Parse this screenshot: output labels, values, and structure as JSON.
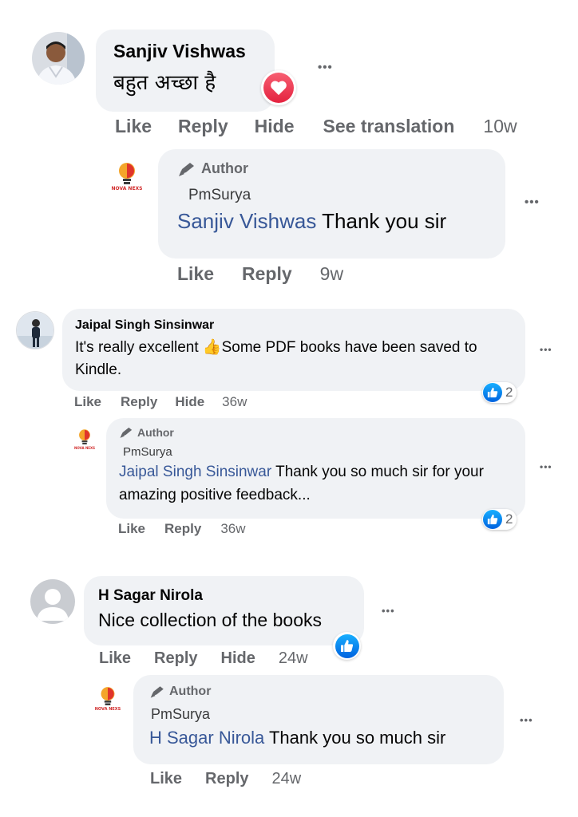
{
  "comments": [
    {
      "name": "Sanjiv Vishwas",
      "text": "बहुत अच्छा है",
      "reaction_icon": "heart-reaction-icon",
      "actions": {
        "like": "Like",
        "reply": "Reply",
        "hide": "Hide",
        "translate": "See translation",
        "time": "10w"
      },
      "more": "•••",
      "reply": {
        "badge": "Author",
        "author": "PmSurya",
        "mention": "Sanjiv Vishwas",
        "text": " Thank you sir",
        "logo_text": "NOVA NEXS",
        "actions": {
          "like": "Like",
          "reply": "Reply",
          "time": "9w"
        },
        "more": "•••"
      }
    },
    {
      "name": "Jaipal Singh Sinsinwar",
      "text_before": "It's really excellent ",
      "emoji": "👍",
      "text_after": "Some PDF books have been saved to Kindle.",
      "reaction_count": "2",
      "actions": {
        "like": "Like",
        "reply": "Reply",
        "hide": "Hide",
        "time": "36w"
      },
      "more": "•••",
      "reply": {
        "badge": "Author",
        "author": "PmSurya",
        "mention": "Jaipal Singh Sinsinwar",
        "text": " Thank you so much sir for your amazing positive feedback...",
        "logo_text": "NOVA NEXS",
        "reaction_count": "2",
        "actions": {
          "like": "Like",
          "reply": "Reply",
          "time": "36w"
        },
        "more": "•••"
      }
    },
    {
      "name": "H Sagar Nirola",
      "text": "Nice collection of the books",
      "reaction_icon": "like-reaction-icon",
      "actions": {
        "like": "Like",
        "reply": "Reply",
        "hide": "Hide",
        "time": "24w"
      },
      "more": "•••",
      "reply": {
        "badge": "Author",
        "author": "PmSurya",
        "mention": "H Sagar Nirola",
        "text": " Thank you so much sir",
        "logo_text": "NOVA NEXS",
        "actions": {
          "like": "Like",
          "reply": "Reply",
          "time": "24w"
        },
        "more": "•••"
      }
    }
  ],
  "colors": {
    "bubble": "#f0f2f5",
    "mention": "#385898",
    "meta": "#65676b",
    "like_blue": "#1877f2",
    "heart": "#f33e58"
  }
}
